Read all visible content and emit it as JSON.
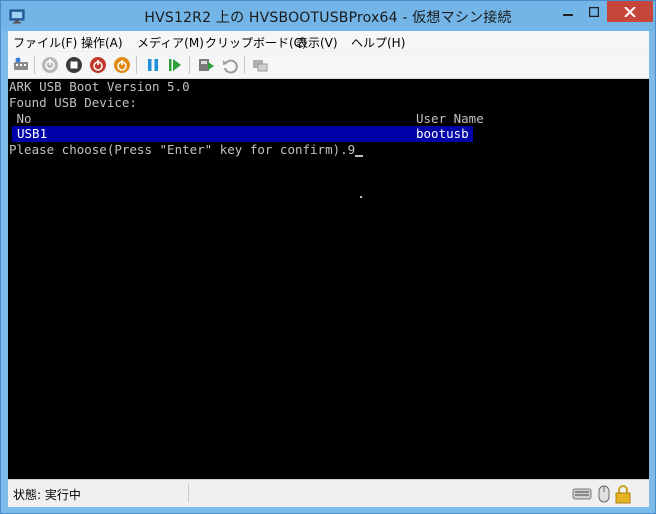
{
  "window": {
    "title": "HVS12R2 上の HVSBOOTUSBProx64  - 仮想マシン接続",
    "app_icon": "vm-connect-icon",
    "controls": [
      "minimize-icon",
      "maximize-icon",
      "close-icon"
    ]
  },
  "menubar": {
    "items": [
      "ファイル(F)",
      "操作(A)",
      "メディア(M)",
      "クリップボード(C)",
      "表示(V)",
      "ヘルプ(H)"
    ]
  },
  "toolbar": {
    "buttons": [
      "ctrl-alt-del-icon",
      "start-icon",
      "turn-off-icon",
      "shutdown-icon",
      "save-icon",
      "pause-icon",
      "resume-icon",
      "checkpoint-icon",
      "revert-icon",
      "enhanced-session-icon"
    ]
  },
  "console": {
    "line1": "ARK USB Boot Version 5.0",
    "line2": "Found USB Device:",
    "header_no": " No",
    "header_user": "User Name",
    "row_no": "USB1",
    "row_user": "bootusb",
    "prompt": "Please choose(Press \"Enter\" key for confirm).9",
    "selected_bg": "#0000a8",
    "text_color": "#c0c0c0"
  },
  "statusbar": {
    "status": "状態: 実行中",
    "tray": [
      "keyboard-icon",
      "mouse-icon",
      "lock-icon"
    ]
  }
}
